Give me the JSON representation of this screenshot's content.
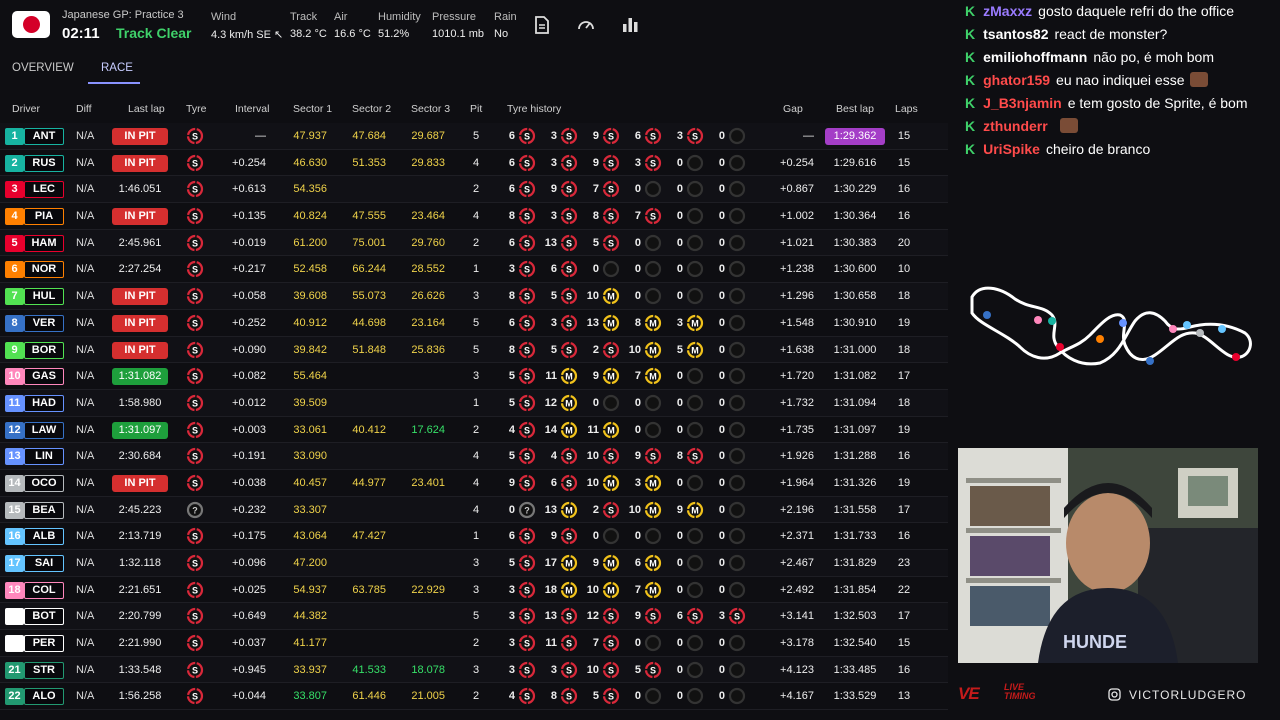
{
  "session": {
    "name": "Japanese GP: Practice 3",
    "clock": "02:11",
    "track_status": "Track Clear"
  },
  "weather": [
    {
      "label": "Wind",
      "value": "4.3 km/h SE ↖"
    },
    {
      "label": "Track",
      "value": "38.2 °C"
    },
    {
      "label": "Air",
      "value": "16.6 °C"
    },
    {
      "label": "Humidity",
      "value": "51.2%"
    },
    {
      "label": "Pressure",
      "value": "1010.1 mb"
    },
    {
      "label": "Rain",
      "value": "No"
    }
  ],
  "toolbar_icons": [
    "document-icon",
    "speedometer-icon",
    "bar-chart-icon"
  ],
  "tabs": [
    {
      "label": "OVERVIEW"
    },
    {
      "label": "RACE"
    }
  ],
  "columns": {
    "driver": "Driver",
    "diff": "Diff",
    "last_lap": "Last lap",
    "tyre": "Tyre",
    "interval": "Interval",
    "sector1": "Sector 1",
    "sector2": "Sector 2",
    "sector3": "Sector 3",
    "pit": "Pit",
    "tyre_history": "Tyre history",
    "gap": "Gap",
    "best_lap": "Best lap",
    "laps": "Laps"
  },
  "colors": {
    "soft": "#d9283a",
    "medium": "#f1c21b",
    "hard": "#ffffff",
    "in_pit": "#d52f2f",
    "best_green": "#1e9f3c",
    "purple": "#a43ec7"
  },
  "drivers": [
    {
      "pos": "1",
      "abbr": "ANT",
      "team": "#17b3a1",
      "diff": "N/A",
      "last": "IN PIT",
      "last_style": "pit",
      "tyre": "S",
      "interval": "—",
      "s1": "47.937",
      "s1c": "yellow",
      "s2": "47.684",
      "s2c": "yellow",
      "s3": "29.687",
      "s3c": "yellow",
      "pit": "5",
      "hist": [
        [
          "6",
          "S"
        ],
        [
          "3",
          "S"
        ],
        [
          "9",
          "S"
        ],
        [
          "6",
          "S"
        ],
        [
          "3",
          "S"
        ],
        [
          "0",
          ""
        ]
      ],
      "gap": "—",
      "best": "1:29.362",
      "best_style": "purple",
      "laps": "15"
    },
    {
      "pos": "2",
      "abbr": "RUS",
      "team": "#17b3a1",
      "diff": "N/A",
      "last": "IN PIT",
      "last_style": "pit",
      "tyre": "S",
      "interval": "+0.254",
      "s1": "46.630",
      "s1c": "yellow",
      "s2": "51.353",
      "s2c": "yellow",
      "s3": "29.833",
      "s3c": "yellow",
      "pit": "4",
      "hist": [
        [
          "6",
          "S"
        ],
        [
          "3",
          "S"
        ],
        [
          "9",
          "S"
        ],
        [
          "3",
          "S"
        ],
        [
          "0",
          ""
        ],
        [
          "0",
          ""
        ]
      ],
      "gap": "+0.254",
      "best": "1:29.616",
      "laps": "15"
    },
    {
      "pos": "3",
      "abbr": "LEC",
      "team": "#e8002d",
      "diff": "N/A",
      "last": "1:46.051",
      "tyre": "S",
      "interval": "+0.613",
      "s1": "54.356",
      "s1c": "yellow",
      "s2": "",
      "s3": "",
      "pit": "2",
      "hist": [
        [
          "6",
          "S"
        ],
        [
          "9",
          "S"
        ],
        [
          "7",
          "S"
        ],
        [
          "0",
          ""
        ],
        [
          "0",
          ""
        ],
        [
          "0",
          ""
        ]
      ],
      "gap": "+0.867",
      "best": "1:30.229",
      "laps": "16"
    },
    {
      "pos": "4",
      "abbr": "PIA",
      "team": "#ff8000",
      "diff": "N/A",
      "last": "IN PIT",
      "last_style": "pit",
      "tyre": "S",
      "interval": "+0.135",
      "s1": "40.824",
      "s1c": "yellow",
      "s2": "47.555",
      "s2c": "yellow",
      "s3": "23.464",
      "s3c": "yellow",
      "pit": "4",
      "hist": [
        [
          "8",
          "S"
        ],
        [
          "3",
          "S"
        ],
        [
          "8",
          "S"
        ],
        [
          "7",
          "S"
        ],
        [
          "0",
          ""
        ],
        [
          "0",
          ""
        ]
      ],
      "gap": "+1.002",
      "best": "1:30.364",
      "laps": "16"
    },
    {
      "pos": "5",
      "abbr": "HAM",
      "team": "#e8002d",
      "diff": "N/A",
      "last": "2:45.961",
      "tyre": "S",
      "interval": "+0.019",
      "s1": "61.200",
      "s1c": "yellow",
      "s2": "75.001",
      "s2c": "yellow",
      "s3": "29.760",
      "s3c": "yellow",
      "pit": "2",
      "hist": [
        [
          "6",
          "S"
        ],
        [
          "13",
          "S"
        ],
        [
          "5",
          "S"
        ],
        [
          "0",
          ""
        ],
        [
          "0",
          ""
        ],
        [
          "0",
          ""
        ]
      ],
      "gap": "+1.021",
      "best": "1:30.383",
      "laps": "20"
    },
    {
      "pos": "6",
      "abbr": "NOR",
      "team": "#ff8000",
      "diff": "N/A",
      "last": "2:27.254",
      "tyre": "S",
      "interval": "+0.217",
      "s1": "52.458",
      "s1c": "yellow",
      "s2": "66.244",
      "s2c": "yellow",
      "s3": "28.552",
      "s3c": "yellow",
      "pit": "1",
      "hist": [
        [
          "3",
          "S"
        ],
        [
          "6",
          "S"
        ],
        [
          "0",
          ""
        ],
        [
          "0",
          ""
        ],
        [
          "0",
          ""
        ],
        [
          "0",
          ""
        ]
      ],
      "gap": "+1.238",
      "best": "1:30.600",
      "laps": "10"
    },
    {
      "pos": "7",
      "abbr": "HUL",
      "team": "#52e252",
      "diff": "N/A",
      "last": "IN PIT",
      "last_style": "pit",
      "tyre": "S",
      "interval": "+0.058",
      "s1": "39.608",
      "s1c": "yellow",
      "s2": "55.073",
      "s2c": "yellow",
      "s3": "26.626",
      "s3c": "yellow",
      "pit": "3",
      "hist": [
        [
          "8",
          "S"
        ],
        [
          "5",
          "S"
        ],
        [
          "10",
          "M"
        ],
        [
          "0",
          ""
        ],
        [
          "0",
          ""
        ],
        [
          "0",
          ""
        ]
      ],
      "gap": "+1.296",
      "best": "1:30.658",
      "laps": "18"
    },
    {
      "pos": "8",
      "abbr": "VER",
      "team": "#3671c6",
      "diff": "N/A",
      "last": "IN PIT",
      "last_style": "pit",
      "tyre": "S",
      "interval": "+0.252",
      "s1": "40.912",
      "s1c": "yellow",
      "s2": "44.698",
      "s2c": "yellow",
      "s3": "23.164",
      "s3c": "yellow",
      "pit": "5",
      "hist": [
        [
          "6",
          "S"
        ],
        [
          "3",
          "S"
        ],
        [
          "13",
          "M"
        ],
        [
          "8",
          "M"
        ],
        [
          "3",
          "M"
        ],
        [
          "0",
          ""
        ]
      ],
      "gap": "+1.548",
      "best": "1:30.910",
      "laps": "19"
    },
    {
      "pos": "9",
      "abbr": "BOR",
      "team": "#52e252",
      "diff": "N/A",
      "last": "IN PIT",
      "last_style": "pit",
      "tyre": "S",
      "interval": "+0.090",
      "s1": "39.842",
      "s1c": "yellow",
      "s2": "51.848",
      "s2c": "yellow",
      "s3": "25.836",
      "s3c": "yellow",
      "pit": "5",
      "hist": [
        [
          "8",
          "S"
        ],
        [
          "5",
          "S"
        ],
        [
          "2",
          "S"
        ],
        [
          "10",
          "M"
        ],
        [
          "5",
          "M"
        ],
        [
          "0",
          ""
        ]
      ],
      "gap": "+1.638",
      "best": "1:31.000",
      "laps": "18"
    },
    {
      "pos": "10",
      "abbr": "GAS",
      "team": "#ff87bc",
      "diff": "N/A",
      "last": "1:31.082",
      "last_style": "best",
      "tyre": "S",
      "interval": "+0.082",
      "s1": "55.464",
      "s1c": "yellow",
      "s2": "",
      "s3": "",
      "pit": "3",
      "hist": [
        [
          "5",
          "S"
        ],
        [
          "11",
          "M"
        ],
        [
          "9",
          "M"
        ],
        [
          "7",
          "M"
        ],
        [
          "0",
          ""
        ],
        [
          "0",
          ""
        ]
      ],
      "gap": "+1.720",
      "best": "1:31.082",
      "laps": "17"
    },
    {
      "pos": "11",
      "abbr": "HAD",
      "team": "#6692ff",
      "diff": "N/A",
      "last": "1:58.980",
      "tyre": "S",
      "interval": "+0.012",
      "s1": "39.509",
      "s1c": "yellow",
      "s2": "",
      "s3": "",
      "pit": "1",
      "hist": [
        [
          "5",
          "S"
        ],
        [
          "12",
          "M"
        ],
        [
          "0",
          ""
        ],
        [
          "0",
          ""
        ],
        [
          "0",
          ""
        ],
        [
          "0",
          ""
        ]
      ],
      "gap": "+1.732",
      "best": "1:31.094",
      "laps": "18"
    },
    {
      "pos": "12",
      "abbr": "LAW",
      "team": "#3671c6",
      "diff": "N/A",
      "last": "1:31.097",
      "last_style": "best",
      "tyre": "S",
      "interval": "+0.003",
      "s1": "33.061",
      "s1c": "yellow",
      "s2": "40.412",
      "s2c": "yellow",
      "s3": "17.624",
      "s3c": "green",
      "pit": "2",
      "hist": [
        [
          "4",
          "S"
        ],
        [
          "14",
          "M"
        ],
        [
          "11",
          "M"
        ],
        [
          "0",
          ""
        ],
        [
          "0",
          ""
        ],
        [
          "0",
          ""
        ]
      ],
      "gap": "+1.735",
      "best": "1:31.097",
      "laps": "19"
    },
    {
      "pos": "13",
      "abbr": "LIN",
      "team": "#6692ff",
      "diff": "N/A",
      "last": "2:30.684",
      "tyre": "S",
      "interval": "+0.191",
      "s1": "33.090",
      "s1c": "yellow",
      "s2": "",
      "s3": "",
      "pit": "4",
      "hist": [
        [
          "5",
          "S"
        ],
        [
          "4",
          "S"
        ],
        [
          "10",
          "S"
        ],
        [
          "9",
          "S"
        ],
        [
          "8",
          "S"
        ],
        [
          "0",
          ""
        ]
      ],
      "gap": "+1.926",
      "best": "1:31.288",
      "laps": "16"
    },
    {
      "pos": "14",
      "abbr": "OCO",
      "team": "#b6babd",
      "diff": "N/A",
      "last": "IN PIT",
      "last_style": "pit",
      "tyre": "S",
      "interval": "+0.038",
      "s1": "40.457",
      "s1c": "yellow",
      "s2": "44.977",
      "s2c": "yellow",
      "s3": "23.401",
      "s3c": "yellow",
      "pit": "4",
      "hist": [
        [
          "9",
          "S"
        ],
        [
          "6",
          "S"
        ],
        [
          "10",
          "M"
        ],
        [
          "3",
          "M"
        ],
        [
          "0",
          ""
        ],
        [
          "0",
          ""
        ]
      ],
      "gap": "+1.964",
      "best": "1:31.326",
      "laps": "19"
    },
    {
      "pos": "15",
      "abbr": "BEA",
      "team": "#b6babd",
      "diff": "N/A",
      "last": "2:45.223",
      "tyre": "?",
      "interval": "+0.232",
      "s1": "33.307",
      "s1c": "yellow",
      "s2": "",
      "s3": "",
      "pit": "4",
      "hist": [
        [
          "0",
          "?"
        ],
        [
          "13",
          "M"
        ],
        [
          "2",
          "S"
        ],
        [
          "10",
          "M"
        ],
        [
          "9",
          "M"
        ],
        [
          "0",
          ""
        ]
      ],
      "gap": "+2.196",
      "best": "1:31.558",
      "laps": "17"
    },
    {
      "pos": "16",
      "abbr": "ALB",
      "team": "#64c4ff",
      "diff": "N/A",
      "last": "2:13.719",
      "tyre": "S",
      "interval": "+0.175",
      "s1": "43.064",
      "s1c": "yellow",
      "s2": "47.427",
      "s2c": "yellow",
      "s3": "",
      "pit": "1",
      "hist": [
        [
          "6",
          "S"
        ],
        [
          "9",
          "S"
        ],
        [
          "0",
          ""
        ],
        [
          "0",
          ""
        ],
        [
          "0",
          ""
        ],
        [
          "0",
          ""
        ]
      ],
      "gap": "+2.371",
      "best": "1:31.733",
      "laps": "16"
    },
    {
      "pos": "17",
      "abbr": "SAI",
      "team": "#64c4ff",
      "diff": "N/A",
      "last": "1:32.118",
      "tyre": "S",
      "interval": "+0.096",
      "s1": "47.200",
      "s1c": "yellow",
      "s2": "",
      "s3": "",
      "pit": "3",
      "hist": [
        [
          "5",
          "S"
        ],
        [
          "17",
          "M"
        ],
        [
          "9",
          "M"
        ],
        [
          "6",
          "M"
        ],
        [
          "0",
          ""
        ],
        [
          "0",
          ""
        ]
      ],
      "gap": "+2.467",
      "best": "1:31.829",
      "laps": "23"
    },
    {
      "pos": "18",
      "abbr": "COL",
      "team": "#ff87bc",
      "diff": "N/A",
      "last": "2:21.651",
      "tyre": "S",
      "interval": "+0.025",
      "s1": "54.937",
      "s1c": "yellow",
      "s2": "63.785",
      "s2c": "yellow",
      "s3": "22.929",
      "s3c": "yellow",
      "pit": "3",
      "hist": [
        [
          "3",
          "S"
        ],
        [
          "18",
          "M"
        ],
        [
          "10",
          "M"
        ],
        [
          "7",
          "M"
        ],
        [
          "0",
          ""
        ],
        [
          "0",
          ""
        ]
      ],
      "gap": "+2.492",
      "best": "1:31.854",
      "laps": "22"
    },
    {
      "pos": "19",
      "abbr": "BOT",
      "team": "#ffffff",
      "diff": "N/A",
      "last": "2:20.799",
      "tyre": "S",
      "interval": "+0.649",
      "s1": "44.382",
      "s1c": "yellow",
      "s2": "",
      "s3": "",
      "pit": "5",
      "hist": [
        [
          "3",
          "S"
        ],
        [
          "13",
          "S"
        ],
        [
          "12",
          "S"
        ],
        [
          "9",
          "S"
        ],
        [
          "6",
          "S"
        ],
        [
          "3",
          "S"
        ]
      ],
      "gap": "+3.141",
      "best": "1:32.503",
      "laps": "17"
    },
    {
      "pos": "20",
      "abbr": "PER",
      "team": "#ffffff",
      "diff": "N/A",
      "last": "2:21.990",
      "tyre": "S",
      "interval": "+0.037",
      "s1": "41.177",
      "s1c": "yellow",
      "s2": "",
      "s3": "",
      "pit": "2",
      "hist": [
        [
          "3",
          "S"
        ],
        [
          "11",
          "S"
        ],
        [
          "7",
          "S"
        ],
        [
          "0",
          ""
        ],
        [
          "0",
          ""
        ],
        [
          "0",
          ""
        ]
      ],
      "gap": "+3.178",
      "best": "1:32.540",
      "laps": "15"
    },
    {
      "pos": "21",
      "abbr": "STR",
      "team": "#229971",
      "diff": "N/A",
      "last": "1:33.548",
      "tyre": "S",
      "interval": "+0.945",
      "s1": "33.937",
      "s1c": "yellow",
      "s2": "41.533",
      "s2c": "green",
      "s3": "18.078",
      "s3c": "green",
      "pit": "3",
      "hist": [
        [
          "3",
          "S"
        ],
        [
          "3",
          "S"
        ],
        [
          "10",
          "S"
        ],
        [
          "5",
          "S"
        ],
        [
          "0",
          ""
        ],
        [
          "0",
          ""
        ]
      ],
      "gap": "+4.123",
      "best": "1:33.485",
      "laps": "16"
    },
    {
      "pos": "22",
      "abbr": "ALO",
      "team": "#229971",
      "diff": "N/A",
      "last": "1:56.258",
      "tyre": "S",
      "interval": "+0.044",
      "s1": "33.807",
      "s1c": "green",
      "s2": "61.446",
      "s2c": "yellow",
      "s3": "21.005",
      "s3c": "yellow",
      "pit": "2",
      "hist": [
        [
          "4",
          "S"
        ],
        [
          "8",
          "S"
        ],
        [
          "5",
          "S"
        ],
        [
          "0",
          ""
        ],
        [
          "0",
          ""
        ],
        [
          "0",
          ""
        ]
      ],
      "gap": "+4.167",
      "best": "1:33.529",
      "laps": "13"
    }
  ],
  "chat": [
    {
      "user": "zMaxxz",
      "color": "#9a7bff",
      "text": "gosto daquele refri do the office"
    },
    {
      "user": "tsantos82",
      "color": "#ffffff",
      "text": "react de monster?"
    },
    {
      "user": "emiliohoffmann",
      "color": "#ffffff",
      "text": "não po, é moh bom"
    },
    {
      "user": "ghator159",
      "color": "#ff4b4b",
      "text": "eu nao indiquei esse",
      "emote": true
    },
    {
      "user": "J_B3njamin",
      "color": "#ff4b4b",
      "text": "e tem gosto de Sprite, é bom"
    },
    {
      "user": "zthunderr",
      "color": "#ff4b4b",
      "text": "",
      "emote": true
    },
    {
      "user": "UriSpike",
      "color": "#ff4b4b",
      "text": "cheiro de branco"
    }
  ],
  "brand": {
    "logo": "VE",
    "sub1": "LIVE",
    "sub2": "TIMING",
    "handle": "VICTORLUDGERO"
  }
}
